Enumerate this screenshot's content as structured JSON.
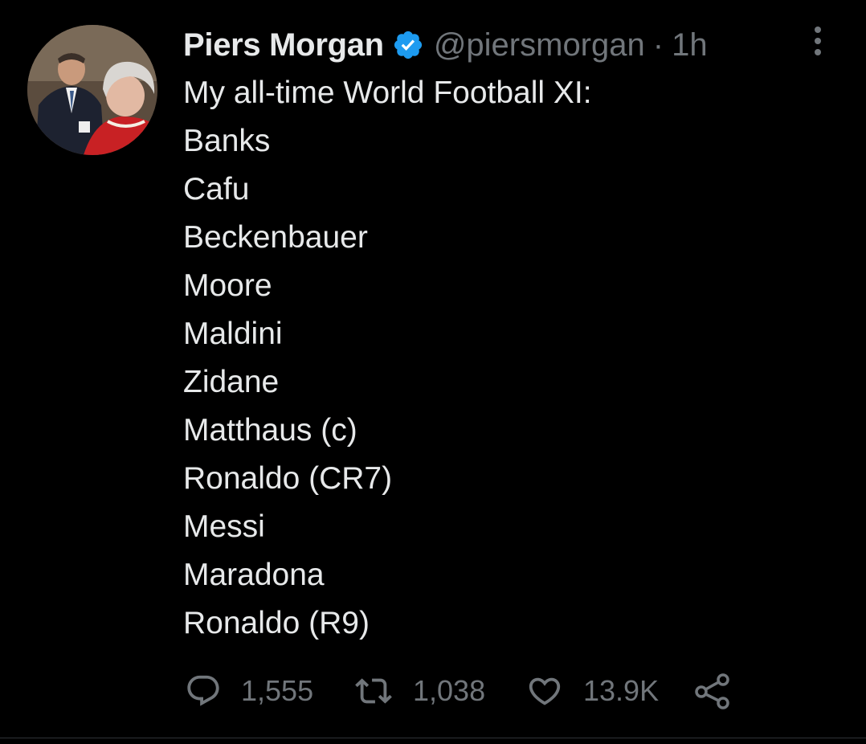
{
  "tweet": {
    "author": {
      "display_name": "Piers Morgan",
      "handle": "@piersmorgan",
      "verified": true
    },
    "separator": "·",
    "time": "1h",
    "lines": [
      "My all-time World Football XI:",
      "Banks",
      "Cafu",
      "Beckenbauer",
      "Moore",
      "Maldini",
      "Zidane",
      "Matthaus (c)",
      "Ronaldo (CR7)",
      "Messi",
      "Maradona",
      "Ronaldo (R9)"
    ],
    "stats": {
      "replies": "1,555",
      "retweets": "1,038",
      "likes": "13.9K"
    }
  },
  "icons": {
    "verified": "verified-badge-icon",
    "more": "more-vertical-icon",
    "reply": "reply-icon",
    "retweet": "retweet-icon",
    "like": "heart-icon",
    "share": "share-icon"
  },
  "colors": {
    "background": "#000000",
    "text_primary": "#e7e9ea",
    "text_secondary": "#71767b",
    "verified_blue": "#1d9bf0"
  }
}
